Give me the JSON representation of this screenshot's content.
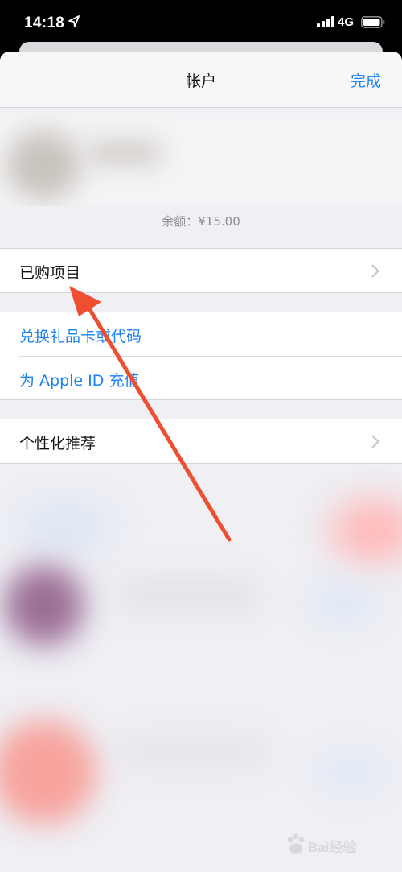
{
  "status_bar": {
    "time": "14:18",
    "network": "4G"
  },
  "nav": {
    "title": "帐户",
    "done_label": "完成"
  },
  "account": {
    "balance": "余额：¥15.00"
  },
  "sections": {
    "purchased": {
      "label": "已购项目"
    },
    "redeem": {
      "label": "兑换礼品卡或代码"
    },
    "add_funds": {
      "label": "为 Apple ID 充值"
    },
    "personalized": {
      "label": "个性化推荐"
    }
  },
  "watermark": {
    "text": "Bai经验"
  },
  "colors": {
    "accent": "#1a82f5",
    "annotation_arrow": "#f04e30"
  }
}
